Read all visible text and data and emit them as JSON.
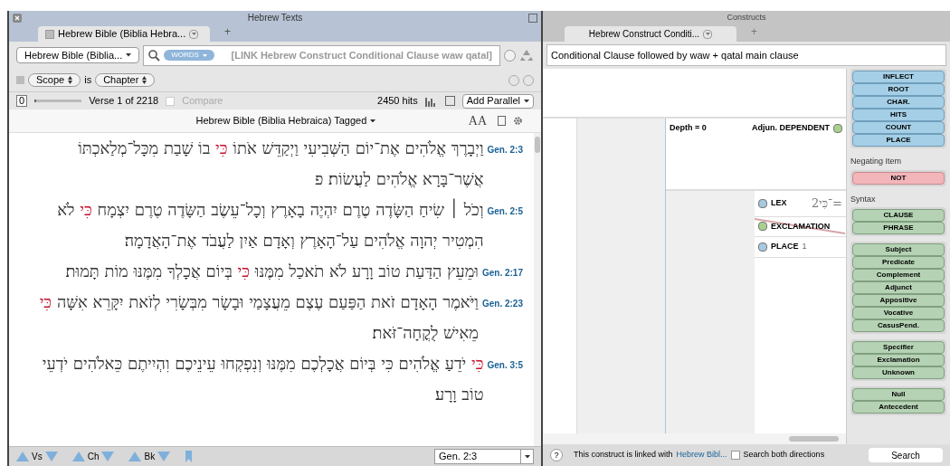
{
  "left_window": {
    "title": "Hebrew Texts",
    "tabs": [
      {
        "label": "Hebrew Bible (Biblia Hebra...",
        "selected": true
      }
    ],
    "new_tab": "+",
    "resource_picker": "Hebrew Bible (Biblia...",
    "search_mode": "WORDS",
    "search_query": "[LINK Hebrew Construct Conditional Clause waw qatal]",
    "scope": {
      "field": "Scope",
      "operator": "is",
      "value": "Chapter"
    },
    "slider_value": "0",
    "slider": {
      "level": 0
    },
    "verse_counter": "Verse 1 of 2218",
    "compare": {
      "label": "Compare",
      "checked": false,
      "disabled": true
    },
    "hits": "2450 hits",
    "add_parallel": "Add Parallel",
    "text_title": "Hebrew Bible (Biblia Hebraica) Tagged",
    "font_size_label": "AA",
    "verses": [
      {
        "ref": "Gen. 2:3",
        "segments": [
          {
            "text": "וַיְבָרֶךְ אֱלֹהִים אֶת־יוֹם הַשְּׁבִיעִי וַיְקַדֵּשׁ אֹתוֹ",
            "hit": false
          },
          {
            "text": "כִּי",
            "hit": true
          },
          {
            "text": "בוֹ שָׁבַת מִכָּל־מְלַאכְתּוֹ אֲשֶׁר־בָּרָא אֱלֹהִים לַעֲשׂוֹת׃ פ",
            "hit": false
          }
        ]
      },
      {
        "ref": "Gen. 2:5",
        "segments": [
          {
            "text": "וְכֹל ׀ שִׂיחַ הַשָּׂדֶה טֶרֶם יִהְיֶה בָאָרֶץ וְכָל־עֵשֶׂב הַשָּׂדֶה טֶרֶם יִצְמָח",
            "hit": false
          },
          {
            "text": "כִּי",
            "hit": true
          },
          {
            "text": "לֹא הִמְטִיר יְהוָה אֱלֹהִים עַל־הָאָרֶץ וְאָדָם אַיִן לַעֲבֹד אֶת־הָאֲדָמָה׃",
            "hit": false
          }
        ]
      },
      {
        "ref": "Gen. 2:17",
        "segments": [
          {
            "text": "וּמֵעֵץ הַדַּעַת טוֹב וָרָע לֹא תֹאכַל מִמֶּנּוּ",
            "hit": false
          },
          {
            "text": "כִּי",
            "hit": true
          },
          {
            "text": "בְּיוֹם אֲכָלְךָ מִמֶּנּוּ מוֹת תָּמוּת׃",
            "hit": false
          }
        ]
      },
      {
        "ref": "Gen. 2:23",
        "segments": [
          {
            "text": "וַיֹּאמֶר הָאָדָם זֹאת הַפַּעַם עֶצֶם מֵעֲצָמַי וּבָשָׂר מִבְּשָׂרִי לְזֹאת יִקָּרֵא אִשָּׁה",
            "hit": false
          },
          {
            "text": "כִּי",
            "hit": true
          },
          {
            "text": "מֵאִישׁ לֻקֳחָה־זֹּאת׃",
            "hit": false
          }
        ]
      },
      {
        "ref": "Gen. 3:5",
        "segments": [
          {
            "text": "כִּי",
            "hit": true
          },
          {
            "text": "יֹדֵעַ אֱלֹהִים כִּי בְּיוֹם אֲכָלְכֶם מִמֶּנּוּ וְנִפְקְחוּ עֵינֵיכֶם וִהְיִיתֶם כֵּאלֹהִים יֹדְעֵי טוֹב וָרָע׃",
            "hit": false
          }
        ]
      }
    ],
    "nav": [
      "Vs",
      "Ch",
      "Bk"
    ],
    "go_to": "Gen. 2:3"
  },
  "right_window": {
    "title": "Constructs",
    "tabs": [
      {
        "label": "Hebrew Construct Conditi...",
        "selected": true
      }
    ],
    "new_tab": "+",
    "construct_title": "Conditional Clause followed by waw + qatal main clause",
    "node": {
      "depth": "Depth = 0",
      "label": "Adjun. DEPENDENT",
      "color": "#a9d18e"
    },
    "items": [
      {
        "label": "LEX",
        "color": "#a7c8e0",
        "value": "2־כִּי="
      },
      {
        "label": "EXCLAMATION",
        "color": "#a9d18e",
        "crossed": true
      },
      {
        "label": "PLACE",
        "color": "#a7c8e0",
        "count": "1"
      }
    ],
    "palette": [
      {
        "groups": [
          [
            {
              "label": "INFLECT",
              "kind": "blue"
            },
            {
              "label": "ROOT",
              "kind": "blue"
            },
            {
              "label": "CHAR.",
              "kind": "blue"
            },
            {
              "label": "HITS",
              "kind": "blue"
            },
            {
              "label": "COUNT",
              "kind": "blue"
            },
            {
              "label": "PLACE",
              "kind": "blue"
            }
          ]
        ]
      },
      {
        "heading": "Negating Item",
        "groups": [
          [
            {
              "label": "NOT",
              "kind": "pink"
            }
          ]
        ]
      },
      {
        "heading": "Syntax",
        "groups": [
          [
            {
              "label": "CLAUSE",
              "kind": "green"
            },
            {
              "label": "PHRASE",
              "kind": "green"
            }
          ],
          [
            {
              "label": "Subject",
              "kind": "green"
            },
            {
              "label": "Predicate",
              "kind": "green"
            },
            {
              "label": "Complement",
              "kind": "green"
            },
            {
              "label": "Adjunct",
              "kind": "green"
            },
            {
              "label": "Appositive",
              "kind": "green"
            },
            {
              "label": "Vocative",
              "kind": "green"
            },
            {
              "label": "CasusPend.",
              "kind": "green"
            }
          ],
          [
            {
              "label": "Specifier",
              "kind": "green"
            },
            {
              "label": "Exclamation",
              "kind": "green"
            },
            {
              "label": "Unknown",
              "kind": "green"
            }
          ],
          [
            {
              "label": "Null",
              "kind": "green"
            },
            {
              "label": "Antecedent",
              "kind": "green"
            }
          ]
        ]
      }
    ],
    "help": "?",
    "link_text": "This construct is linked with",
    "link": "Hebrew Bibl...",
    "both_directions": {
      "label": "Search both directions",
      "checked": false
    },
    "search_button": "Search"
  }
}
